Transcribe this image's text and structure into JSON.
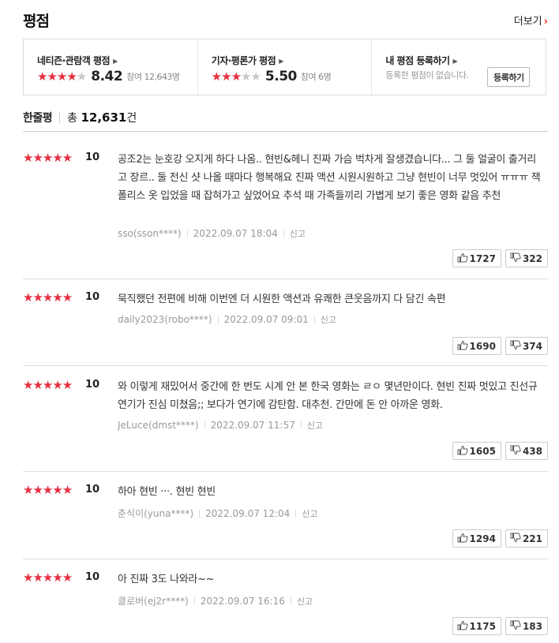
{
  "header": {
    "title": "평점",
    "more_label": "더보기",
    "more_chevron": "›"
  },
  "summary": {
    "netizen": {
      "label": "네티즌·관람객 평점",
      "stars_on": "★★★★",
      "stars_off": "★",
      "score": "8.42",
      "participants": "참여 12,643명"
    },
    "critic": {
      "label": "기자·평론가 평점",
      "stars_on": "★★★",
      "stars_off": "★★",
      "score": "5.50",
      "participants": "참여 6명"
    },
    "mine": {
      "label": "내 평점 등록하기",
      "empty_text": "등록한 평점이 없습니다.",
      "button_label": "등록하기"
    },
    "arrow": "▶"
  },
  "one_line": {
    "label": "한줄평",
    "total_prefix": "총",
    "total_count": "12,631",
    "total_suffix": "건"
  },
  "colors": {
    "star": "#e62e3f",
    "star_off": "#c8c8c8",
    "accent": "#ff1f1f"
  },
  "reviews": [
    {
      "stars": "★★★★★",
      "score": "10",
      "text": "공조2는 눈호강 오지게 하다 나옴.. 현빈&헤니 진짜 가슴 벅차게 잘생겼습니다... 그 둘 얼굴이 출거리고 장르.. 둘 전신 샷 나올 때마다 행복해요 진짜 액션 시원시원하고 그냥 현빈이 너무 멋있어 ㅠㅠㅠ 잭 폴리스 옷 입었을 때 잡혀가고 싶었어요 추석 때 가족들끼리 가볍게 보기 좋은 영화 같음 추천",
      "user": "sso(sson****)",
      "date": "2022.09.07 18:04",
      "report": "신고",
      "likes": "1727",
      "dislikes": "322"
    },
    {
      "stars": "★★★★★",
      "score": "10",
      "text": "묵직했던 전편에 비해 이번엔 더 시원한 액션과 유쾌한 큰웃음까지 다 담긴 속편",
      "user": "daily2023(robo****)",
      "date": "2022.09.07 09:01",
      "report": "신고",
      "likes": "1690",
      "dislikes": "374"
    },
    {
      "stars": "★★★★★",
      "score": "10",
      "text": "와 이렇게 재밌어서 중간에 한 번도 시계 안 본 한국 영화는 ㄹㅇ 몇년만이다. 현빈 진짜 멋있고 진선규 연기가 진심 미쳤음;; 보다가 연기에 감탄함. 대추천. 간만에 돈 안 아까운 영화.",
      "user": "JeLuce(dmst****)",
      "date": "2022.09.07 11:57",
      "report": "신고",
      "likes": "1605",
      "dislikes": "438"
    },
    {
      "stars": "★★★★★",
      "score": "10",
      "text": "하아 현빈 ···. 현빈 현빈",
      "user": "춘식이(yuna****)",
      "date": "2022.09.07 12:04",
      "report": "신고",
      "likes": "1294",
      "dislikes": "221"
    },
    {
      "stars": "★★★★★",
      "score": "10",
      "text": "아 진짜 3도 나와라~~",
      "user": "클로버(ej2r****)",
      "date": "2022.09.07 16:16",
      "report": "신고",
      "likes": "1175",
      "dislikes": "183"
    }
  ]
}
